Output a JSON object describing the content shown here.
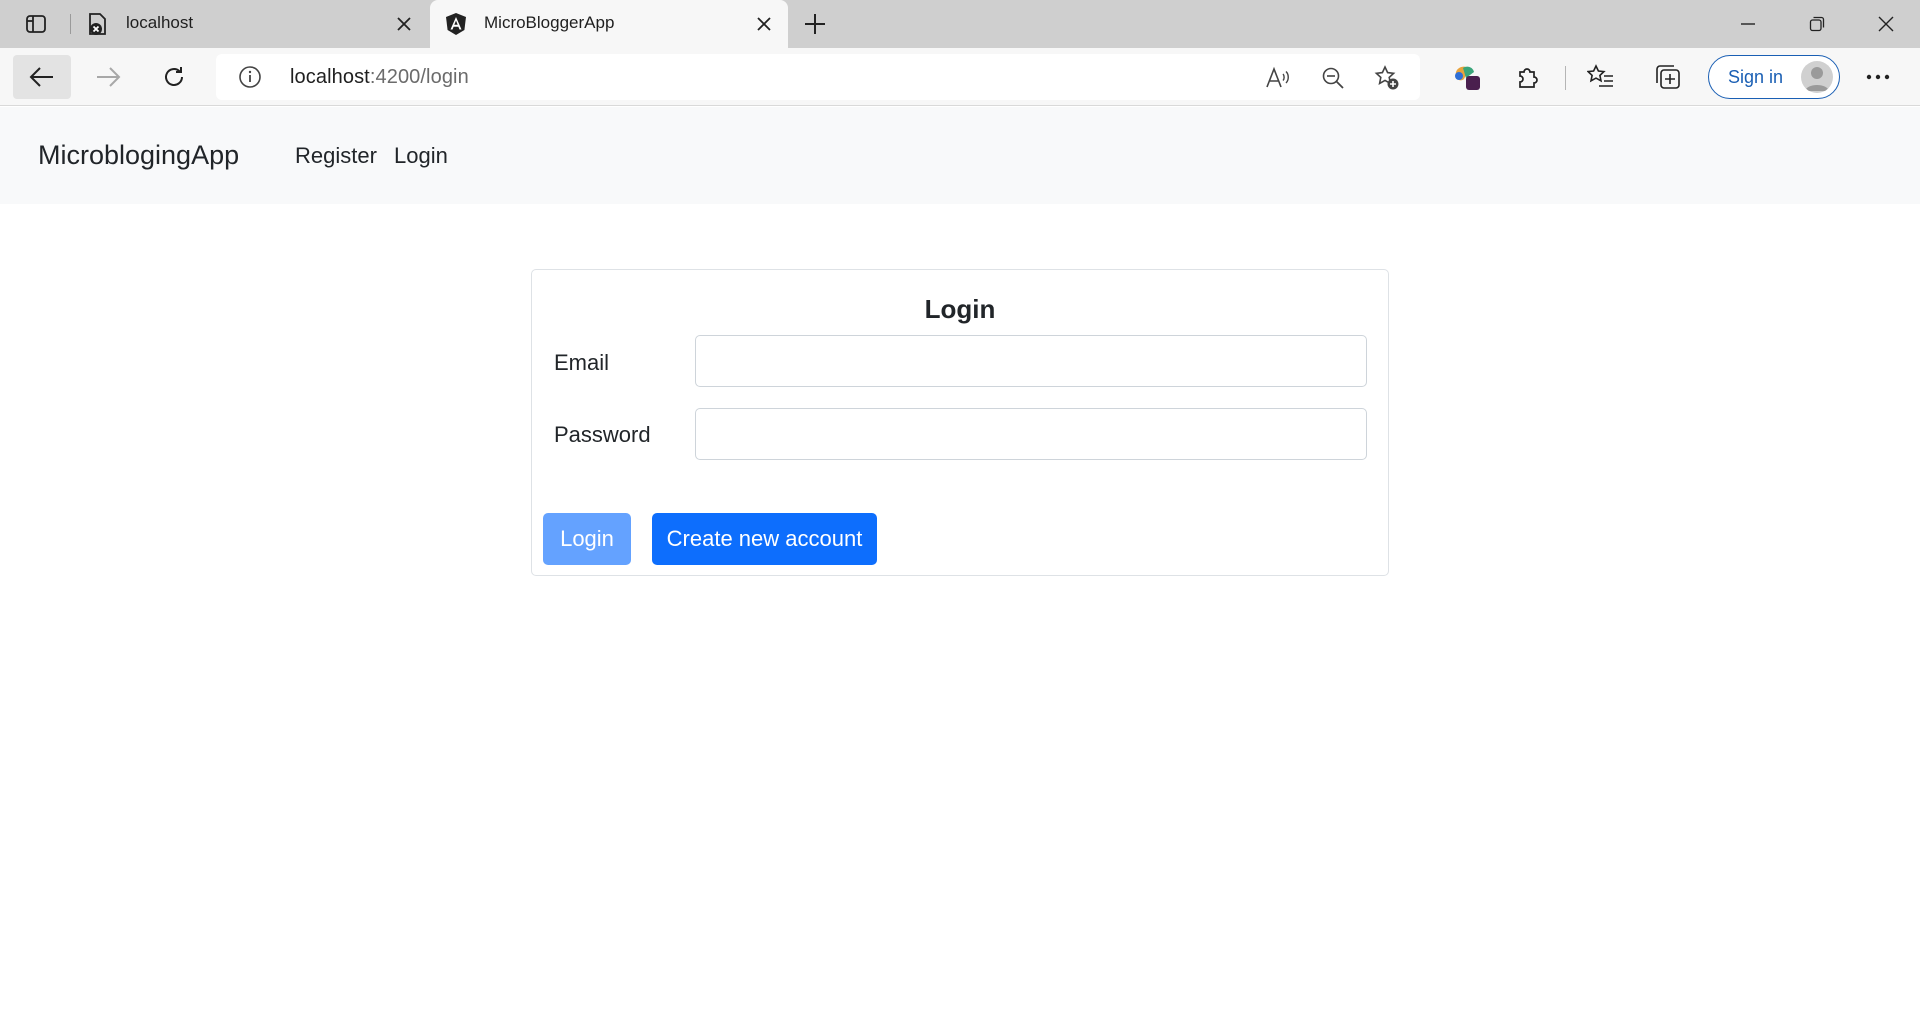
{
  "browser": {
    "tabs": [
      {
        "title": "localhost",
        "active": false
      },
      {
        "title": "MicroBloggerApp",
        "active": true
      }
    ],
    "address": {
      "host": "localhost",
      "path": ":4200/login"
    },
    "sign_in_label": "Sign in",
    "colors": {
      "accent": "#1a5fb4",
      "tabbar": "#cfcfcf",
      "toolbar": "#f7f7f7"
    },
    "icons": [
      "tab-actions-icon",
      "error-page-icon",
      "angular-icon",
      "close-icon",
      "new-tab-icon",
      "minimize-icon",
      "restore-icon",
      "close-window-icon",
      "back-icon",
      "forward-icon",
      "reload-icon",
      "site-info-icon",
      "read-aloud-icon",
      "zoom-out-icon",
      "add-favorite-icon",
      "copilot-icon",
      "extensions-icon",
      "favorites-icon",
      "collections-icon",
      "profile-icon",
      "more-icon"
    ]
  },
  "navbar": {
    "brand": "MicroblogingApp",
    "links": [
      "Register",
      "Login"
    ]
  },
  "login_card": {
    "title": "Login",
    "email_label": "Email",
    "email_value": "",
    "password_label": "Password",
    "password_value": "",
    "login_button": "Login",
    "create_button": "Create new account",
    "colors": {
      "primary": "#0d6efd",
      "primary_disabled": "#64a2ff"
    }
  }
}
